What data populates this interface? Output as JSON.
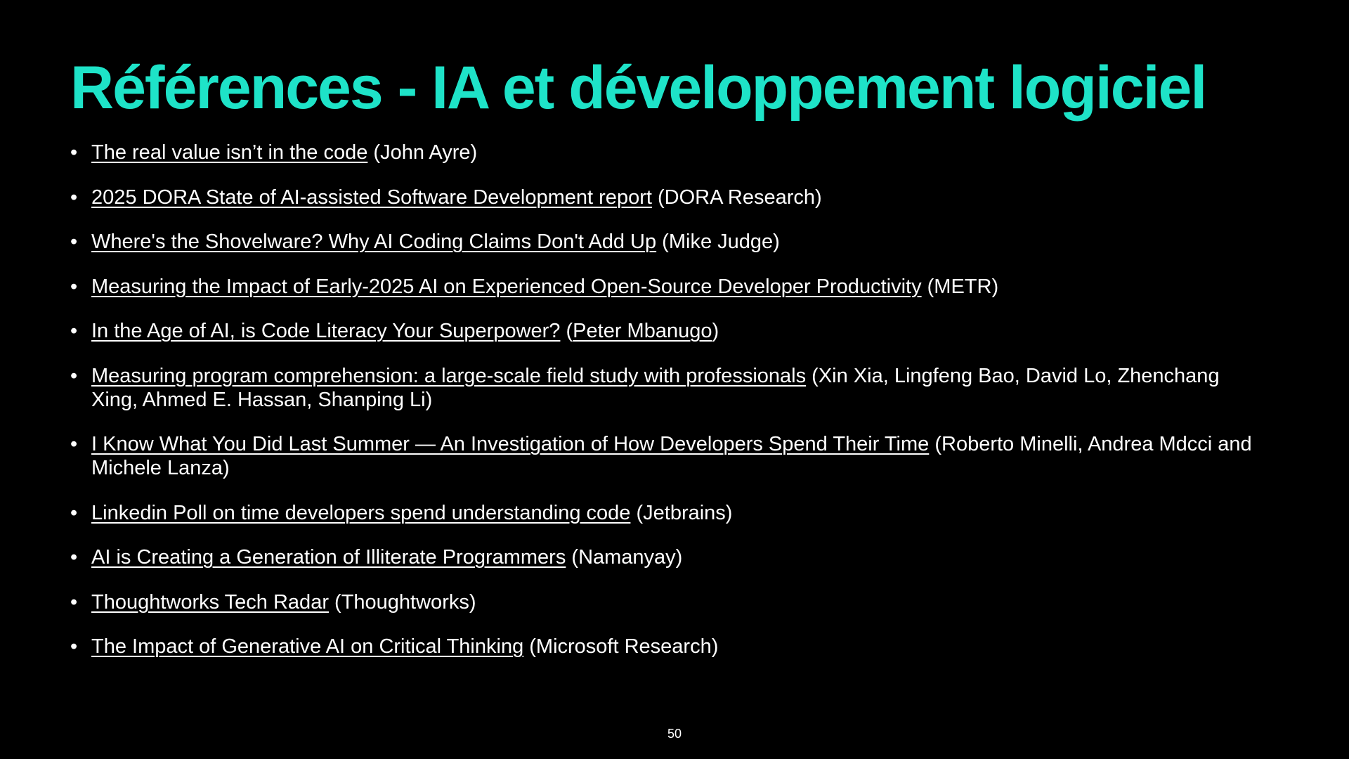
{
  "slide": {
    "title": "Références - IA et développement logiciel",
    "title_color": "#1ee3c8",
    "page_number": "50",
    "bullet_glyph": "•",
    "references": [
      {
        "link": "The real value isn’t in the code",
        "before": " (",
        "link2": "",
        "after": "John Ayre)"
      },
      {
        "link": "2025 DORA State of AI-assisted Software Development report",
        "before": " (",
        "link2": "",
        "after": "DORA Research)"
      },
      {
        "link": "Where's the Shovelware? Why AI Coding Claims Don't Add Up",
        "before": " (",
        "link2": "",
        "after": "Mike Judge)"
      },
      {
        "link": "Measuring the Impact of Early-2025 AI on Experienced Open-Source Developer Productivity",
        "before": " (",
        "link2": "",
        "after": "METR)"
      },
      {
        "link": "In the Age of AI, is Code Literacy Your Superpower?",
        "before": " (",
        "link2": "Peter Mbanugo",
        "after": ")"
      },
      {
        "link": "Measuring program comprehension: a large-scale field study with professionals",
        "before": " (",
        "link2": "",
        "after": "Xin Xia, Lingfeng Bao, David Lo, Zhenchang Xing, Ahmed E. Hassan, Shanping Li)"
      },
      {
        "link": "I Know What You Did Last Summer — An Investigation of How Developers Spend Their Time",
        "before": " (",
        "link2": "",
        "after": "Roberto Minelli, Andrea Mdcci and Michele Lanza)"
      },
      {
        "link": "Linkedin Poll on time developers spend understanding code",
        "before": " (",
        "link2": "",
        "after": "Jetbrains)"
      },
      {
        "link": "AI is Creating a Generation of Illiterate Programmers",
        "before": " (",
        "link2": "",
        "after": "Namanyay)"
      },
      {
        "link": "Thoughtworks Tech Radar",
        "before": " (",
        "link2": "",
        "after": "Thoughtworks)"
      },
      {
        "link": "The Impact of Generative AI on Critical Thinking",
        "before": " (",
        "link2": "",
        "after": "Microsoft Research)"
      }
    ]
  }
}
